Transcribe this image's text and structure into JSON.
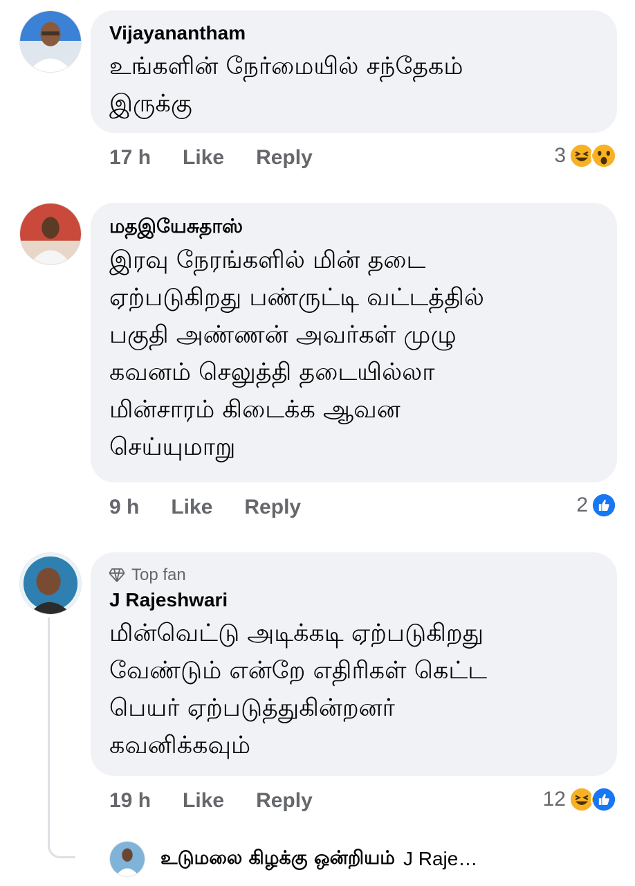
{
  "comments": [
    {
      "author": "Vijayanantham",
      "text": "உங்களின் நேர்மையில் சந்தேகம்\nஇருக்கு",
      "time": "17 h",
      "like_label": "Like",
      "reply_label": "Reply",
      "reaction_count": "3",
      "reactions": [
        "haha-icon",
        "wow-icon"
      ]
    },
    {
      "author": "மதஇயேசுதாஸ்",
      "text": "இரவு நேரங்களில் மின் தடை\nஏற்படுகிறது பண்ருட்டி வட்டத்தில்\nபகுதி அண்ணன் அவர்கள் முழு\nகவனம் செலுத்தி தடையில்லா\nமின்சாரம் கிடைக்க ஆவன\nசெய்யுமாறு",
      "time": "9 h",
      "like_label": "Like",
      "reply_label": "Reply",
      "reaction_count": "2",
      "reactions": [
        "like-icon"
      ]
    },
    {
      "badge": "Top fan",
      "author": "J Rajeshwari",
      "text": "மின்வெட்டு அடிக்கடி ஏற்படுகிறது\nவேண்டும் என்றே எதிரிகள் கெட்ட\nபெயர் ஏற்படுத்துகின்றனர்\nகவனிக்கவும்",
      "time": "19 h",
      "like_label": "Like",
      "reply_label": "Reply",
      "reaction_count": "12",
      "reactions": [
        "haha-icon",
        "like-icon"
      ]
    }
  ],
  "reply_preview": {
    "author": "உடுமலை கிழக்கு ஒன்றியம்",
    "text": "J Raje…"
  },
  "colors": {
    "bubble": "#f0f2f5",
    "meta_text": "#65676b",
    "like_blue": "#1877f2",
    "haha_yellow": "#f7b125"
  }
}
